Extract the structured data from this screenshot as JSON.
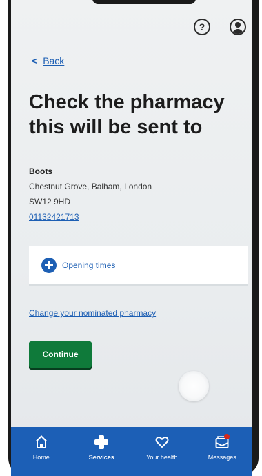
{
  "header": {
    "help_icon": "help-icon",
    "help_glyph": "?",
    "account_icon": "account-icon"
  },
  "back": {
    "label": "Back",
    "glyph": "<"
  },
  "page": {
    "title": "Check the pharmacy this will be sent to"
  },
  "pharmacy": {
    "name": "Boots",
    "address": "Chestnut Grove, Balham, London",
    "postcode": "SW12 9HD",
    "phone": "01132421713"
  },
  "opening_times": {
    "label": "Opening times",
    "icon": "plus-circle-icon"
  },
  "change_link": "Change your nominated pharmacy",
  "continue_label": "Continue",
  "bottom_nav": {
    "items": [
      {
        "label": "Home",
        "icon": "home-icon",
        "active": false
      },
      {
        "label": "Services",
        "icon": "services-cross-icon",
        "active": true
      },
      {
        "label": "Your health",
        "icon": "heart-icon",
        "active": false
      },
      {
        "label": "Messages",
        "icon": "messages-icon",
        "active": false
      }
    ]
  },
  "colors": {
    "link": "#1d5fb4",
    "nav": "#1c5fb6",
    "continue": "#0f7a3a",
    "badge": "#d5281b"
  }
}
